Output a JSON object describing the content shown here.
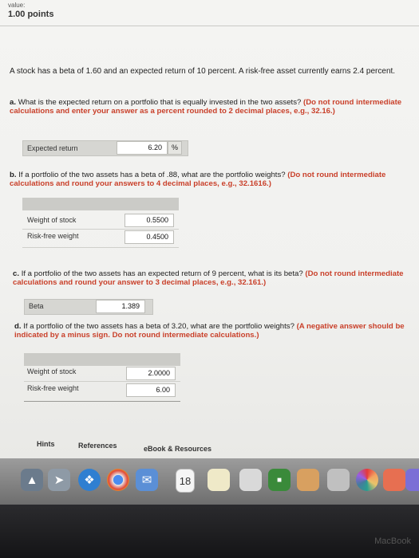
{
  "header": {
    "value_label": "value:",
    "points": "1.00 points"
  },
  "problem": {
    "intro": "A stock has a beta of 1.60 and an expected return of 10 percent. A risk-free asset currently earns 2.4 percent.",
    "a": {
      "prefix": "a.",
      "question": "What is the expected return on a portfolio that is equally invested in the two assets?",
      "instruction": "(Do not round intermediate calculations and enter your answer as a percent rounded to 2 decimal places, e.g., 32.16.)",
      "label": "Expected return",
      "value": "6.20",
      "unit": "%"
    },
    "b": {
      "prefix": "b.",
      "question": "If a portfolio of the two assets has a beta of .88, what are the portfolio weights?",
      "instruction": "(Do not round intermediate calculations and round your answers to 4 decimal places, e.g., 32.1616.)",
      "rows": [
        {
          "label": "Weight of stock",
          "value": "0.5500"
        },
        {
          "label": "Risk-free weight",
          "value": "0.4500"
        }
      ]
    },
    "c": {
      "prefix": "c.",
      "question": "If a portfolio of the two assets has an expected return of 9 percent, what is its beta?",
      "instruction": "(Do not round intermediate calculations and round your answer to 3 decimal places, e.g., 32.161.)",
      "label": "Beta",
      "value": "1.389"
    },
    "d": {
      "prefix": "d.",
      "question": "If a portfolio of the two assets has a beta of 3.20, what are the portfolio weights?",
      "instruction": "(A negative answer should be indicated by a minus sign. Do not round intermediate calculations.)",
      "rows": [
        {
          "label": "Weight of stock",
          "value": "2.0000"
        },
        {
          "label": "Risk-free weight",
          "value": "6.00"
        }
      ]
    }
  },
  "footer_links": {
    "hints": "Hints",
    "references": "References",
    "ebook": "eBook & Resources"
  },
  "dock": {
    "calendar_day": "18",
    "colors": {
      "launchpad": "#6b7b8c",
      "rocket": "#8e9aa6",
      "safari": "#2f7fd1",
      "chrome": "#e0e0e0",
      "mail": "#5b8fd6",
      "calendar": "#f5f5f5"
    }
  },
  "bezel": {
    "brand": "MacBook"
  }
}
